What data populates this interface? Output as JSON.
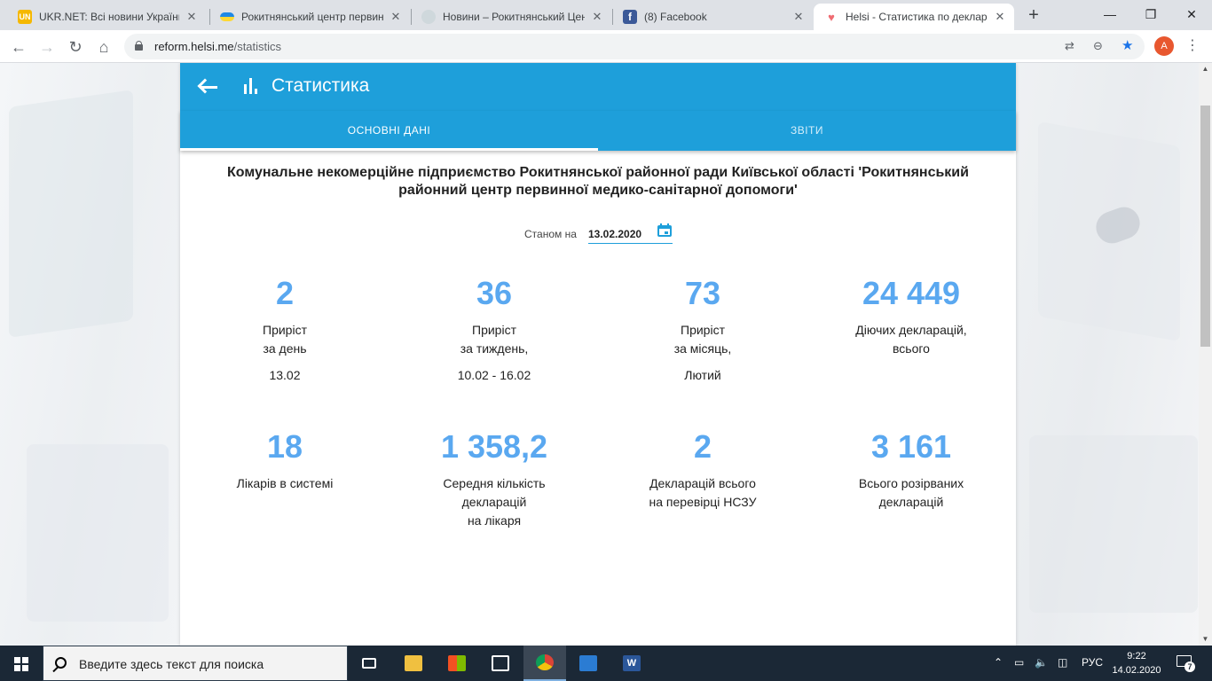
{
  "browser": {
    "tabs": [
      {
        "title": "UKR.NET: Всі новини України, ",
        "favicon": "ukrnet-favicon",
        "favicon_color": "#f5b800",
        "favicon_text": "UN"
      },
      {
        "title": "Рокитнянський центр первинн",
        "favicon": "ukraine-flag-favicon",
        "favicon_color": "#1e88e5",
        "favicon_text": ""
      },
      {
        "title": "Новини – Рокитнянський Цент",
        "favicon": "globe-favicon",
        "favicon_color": "#b0bec5",
        "favicon_text": ""
      },
      {
        "title": "(8) Facebook",
        "favicon": "facebook-favicon",
        "favicon_color": "#3b5998",
        "favicon_text": "f"
      },
      {
        "title": "Helsi - Статистика по декларац",
        "favicon": "helsi-favicon",
        "favicon_color": "#ef6c72",
        "favicon_text": "♥"
      }
    ],
    "new_tab": "+",
    "window_controls": {
      "minimize": "—",
      "maximize": "❐",
      "close": "✕"
    },
    "nav": {
      "back": "←",
      "forward": "→",
      "reload": "↻",
      "home": "⌂"
    },
    "url_host": "reform.helsi.me",
    "url_path": "/statistics",
    "avatar_letter": "A"
  },
  "app": {
    "title": "Статистика",
    "tabs": [
      "ОСНОВНІ ДАНІ",
      "ЗВІТИ"
    ],
    "organization": "Комунальне некомерційне підприємство Рокитнянської районної ради Київської області 'Рокитнянський районний центр первинної медико-санітарної допомоги'",
    "date_label": "Станом на",
    "date_value": "13.02.2020",
    "accent_color": "#1e9fda",
    "number_color": "#5aa8f0",
    "stats_row1": [
      {
        "value": "2",
        "label_line1": "Приріст",
        "label_line2": "за день",
        "sub": "13.02"
      },
      {
        "value": "36",
        "label_line1": "Приріст",
        "label_line2": "за тиждень,",
        "sub": "10.02 - 16.02"
      },
      {
        "value": "73",
        "label_line1": "Приріст",
        "label_line2": "за місяць,",
        "sub": "Лютий"
      },
      {
        "value": "24 449",
        "label_line1": "Діючих декларацій,",
        "label_line2": "всього",
        "sub": ""
      }
    ],
    "stats_row2": [
      {
        "value": "18",
        "label_line1": "Лікарів в системі",
        "label_line2": "",
        "label_line3": ""
      },
      {
        "value": "1 358,2",
        "label_line1": "Середня кількість",
        "label_line2": "декларацій",
        "label_line3": "на лікаря"
      },
      {
        "value": "2",
        "label_line1": "Декларацій всього",
        "label_line2": "на перевірці НСЗУ",
        "label_line3": ""
      },
      {
        "value": "3 161",
        "label_line1": "Всього розірваних",
        "label_line2": "декларацій",
        "label_line3": ""
      }
    ]
  },
  "taskbar": {
    "search_placeholder": "Введите здесь текст для поиска",
    "language": "РУС",
    "time": "9:22",
    "date": "14.02.2020",
    "notifications_count": "7"
  }
}
